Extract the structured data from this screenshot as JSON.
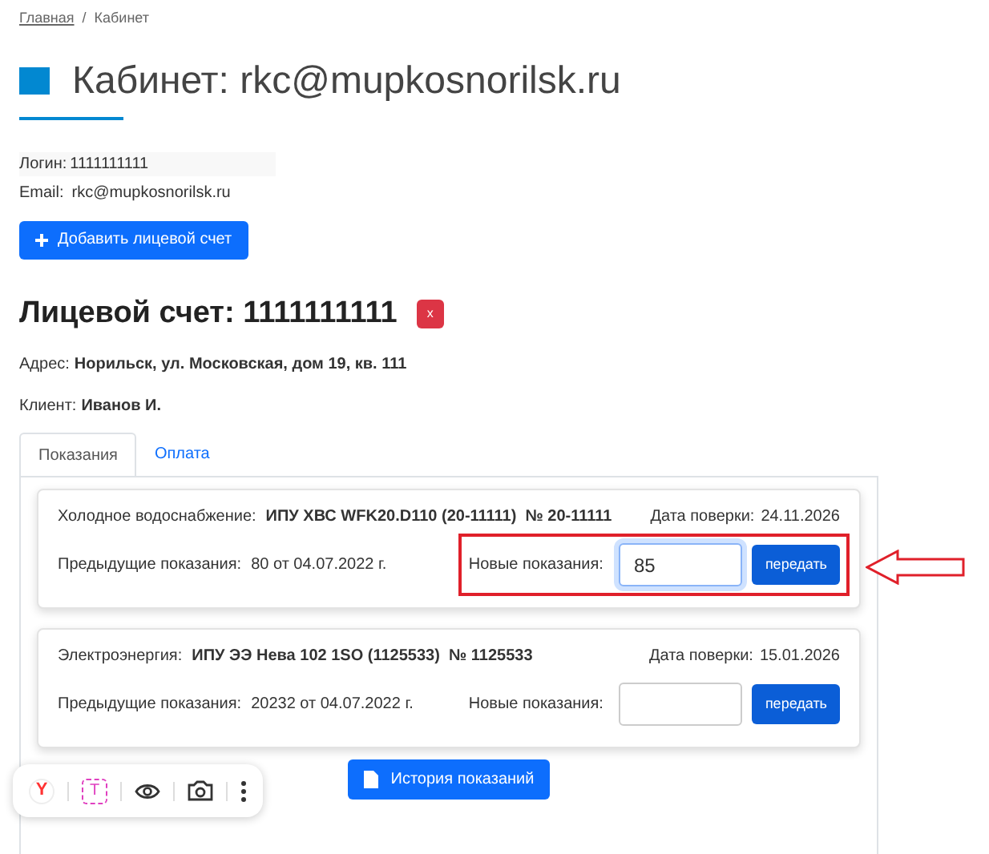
{
  "breadcrumbs": [
    {
      "label": "Главная",
      "link": true
    },
    {
      "label": "Кабинет",
      "link": false
    }
  ],
  "breadcrumb_separator": "/",
  "title": "Кабинет: rkc@mupkosnorilsk.ru",
  "login": {
    "label": "Логин:",
    "value": "1111111111"
  },
  "email": {
    "label": "Email:",
    "value": "rkc@mupkosnorilsk.ru"
  },
  "add_button": "Добавить лицевой счет",
  "account": {
    "title": "Лицевой счет: 1111111111",
    "delete": "x",
    "address_label": "Адрес:",
    "address": "Норильск, ул. Московская, дом 19, кв. 111",
    "client_label": "Клиент:",
    "client": "Иванов И."
  },
  "tabs": [
    {
      "label": "Показания",
      "selected": true
    },
    {
      "label": "Оплата",
      "selected": false
    }
  ],
  "meters": [
    {
      "service": "Холодное водоснабжение:",
      "device": "ИПУ ХВС WFK20.D110 (20-11111)  № 20-11111",
      "check_label": "Дата поверки:",
      "check_date": "24.11.2026",
      "prev_label": "Предыдущие показания:",
      "prev_value": "80 от 04.07.2022 г.",
      "new_label": "Новые показания:",
      "value": "85",
      "focused": true,
      "button": "передать",
      "highlighted": true
    },
    {
      "service": "Электроэнергия:",
      "device": "ИПУ ЭЭ Нева 102 1SO (1125533)  № 1125533",
      "check_label": "Дата поверки:",
      "check_date": "15.01.2026",
      "prev_label": "Предыдущие показания:",
      "prev_value": "20232 от 04.07.2022 г.",
      "new_label": "Новые показания:",
      "focused": false,
      "button": "передать",
      "highlighted": false
    }
  ],
  "history_button": "История показаний",
  "toolbar": {
    "logo": "Y",
    "text_icon": "T"
  }
}
